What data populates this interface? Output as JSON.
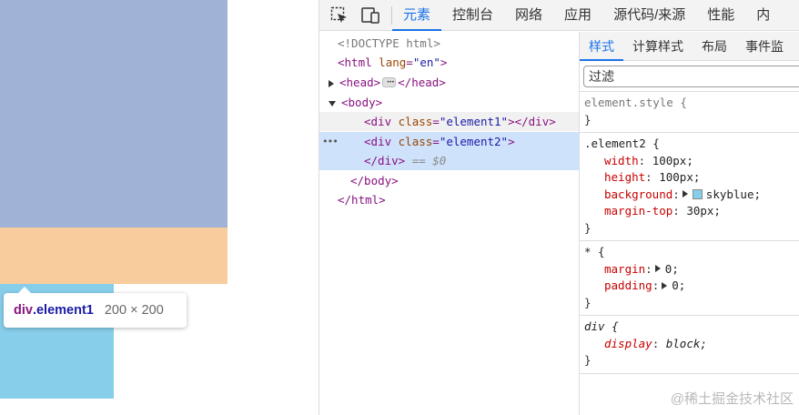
{
  "preview": {
    "colors": {
      "content": "#a0b2d6",
      "margin": "#f8cc9d",
      "element2": "#87ceeb"
    },
    "tooltip": {
      "tag": "div",
      "cls": ".element1",
      "size": "200 × 200"
    }
  },
  "devtools": {
    "toolbar": {
      "inspect_icon": "select-element-icon",
      "device_icon": "device-toolbar-icon"
    },
    "tabs": [
      "元素",
      "控制台",
      "网络",
      "应用",
      "源代码/来源",
      "性能",
      "内"
    ],
    "dom": {
      "doctype": "<!DOCTYPE html>",
      "html_open_tag": "<html",
      "html_lang_attr": "lang",
      "html_lang_val": "\"en\"",
      "html_open_close": ">",
      "head_open": "<head>",
      "head_close": "</head>",
      "body_open": "<body>",
      "div_open": "<div",
      "class_attr": "class",
      "el1_val": "\"element1\"",
      "el1_close": "></div>",
      "el2_val": "\"element2\"",
      "el2_close": ">",
      "div_close": "</div>",
      "selected_marker": "== $0",
      "body_close": "</body>",
      "html_close": "</html>",
      "eq_sign": "="
    },
    "styles": {
      "subtabs": [
        "样式",
        "计算样式",
        "布局",
        "事件监"
      ],
      "filter_placeholder": "过滤",
      "rules": [
        {
          "selector": "element.style {",
          "close": "}",
          "props": []
        },
        {
          "selector": ".element2 {",
          "close": "}",
          "props": [
            {
              "name": "width",
              "value": "100px;"
            },
            {
              "name": "height",
              "value": "100px;"
            },
            {
              "name": "background",
              "value": "skyblue;",
              "swatch": "#87ceeb"
            },
            {
              "name": "margin-top",
              "value": "30px;"
            }
          ]
        },
        {
          "selector": "* {",
          "close": "}",
          "props": [
            {
              "name": "margin",
              "value": "0;"
            },
            {
              "name": "padding",
              "value": "0;"
            }
          ]
        },
        {
          "selector": "div {",
          "close": "}",
          "props": [
            {
              "name": "display",
              "value": "block;"
            }
          ]
        }
      ]
    },
    "watermark": "@稀土掘金技术社区"
  }
}
